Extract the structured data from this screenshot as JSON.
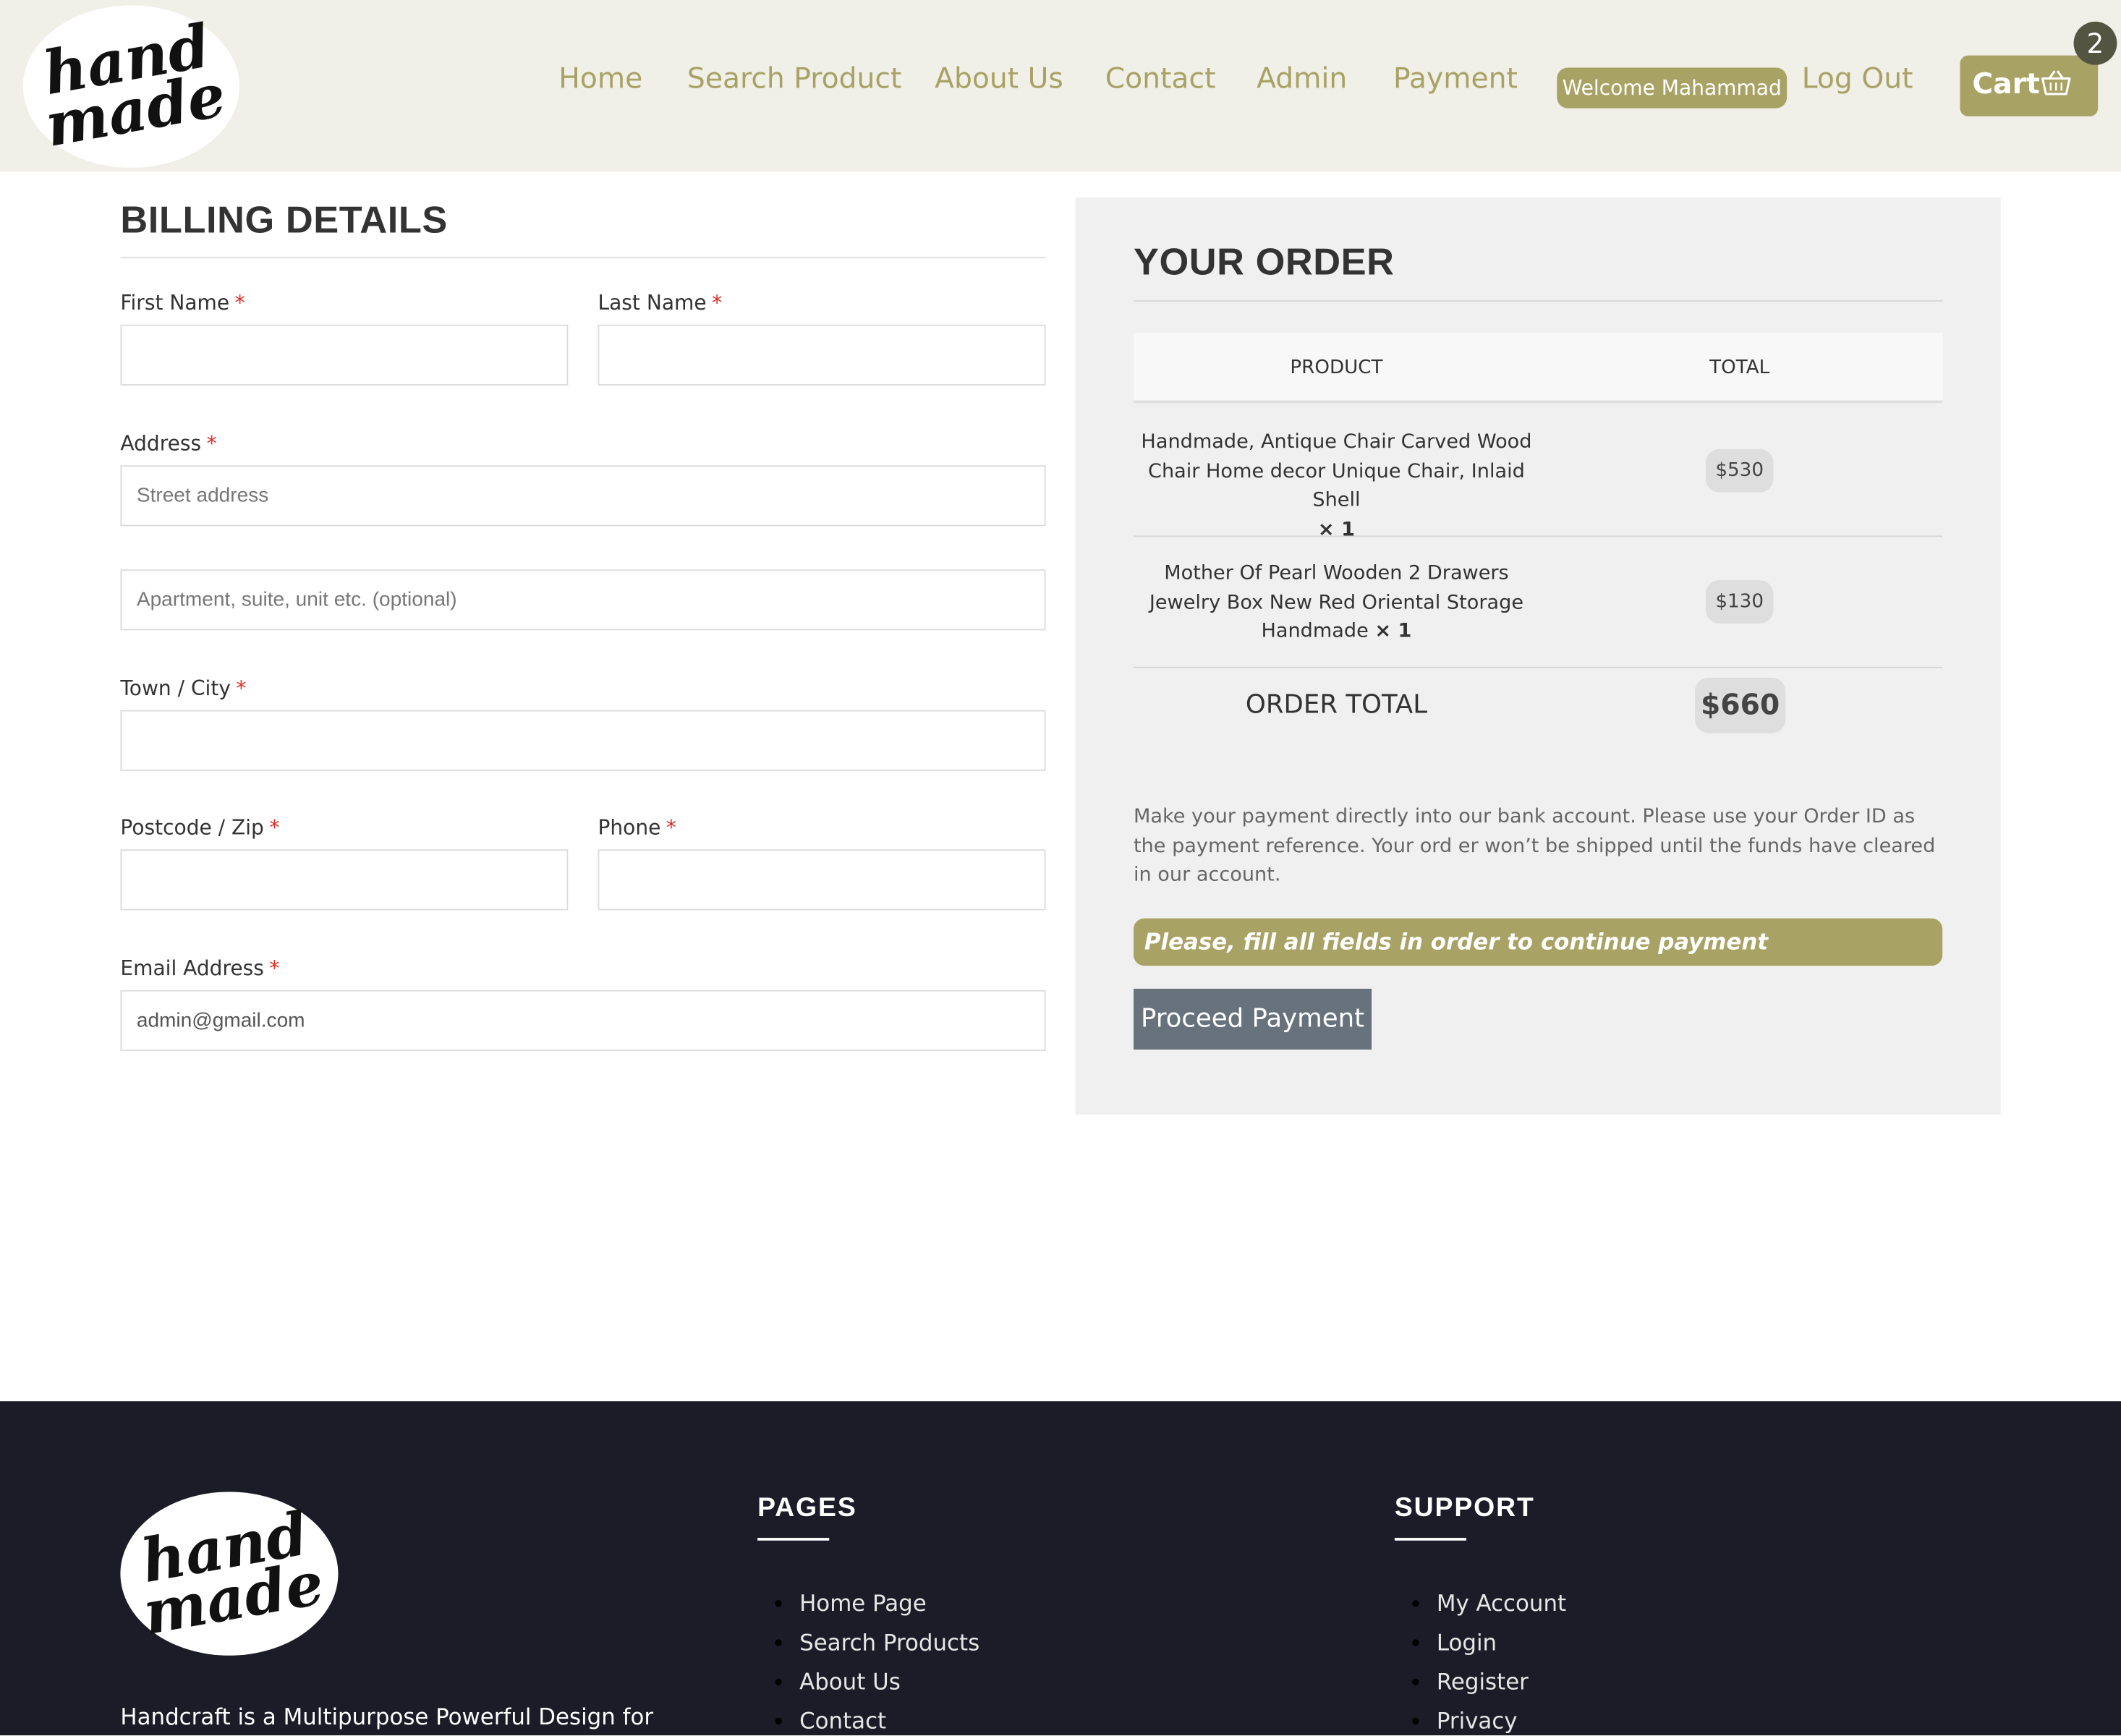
{
  "header": {
    "logo_text": "hand made",
    "nav": [
      "Home",
      "Search Product",
      "About Us",
      "Contact",
      "Admin",
      "Payment"
    ],
    "welcome": "Welcome Mahammad",
    "logout": "Log Out",
    "cart_label": "Cart",
    "cart_count": "2"
  },
  "billing": {
    "title": "BILLING DETAILS",
    "required_mark": "*",
    "first_name_label": "First Name",
    "last_name_label": "Last Name",
    "address_label": "Address",
    "street_placeholder": "Street address",
    "apartment_placeholder": "Apartment, suite, unit etc. (optional)",
    "town_label": "Town / City",
    "postcode_label": "Postcode / Zip",
    "phone_label": "Phone",
    "email_label": "Email Address",
    "email_value": "admin@gmail.com"
  },
  "order": {
    "title": "YOUR ORDER",
    "col_product": "PRODUCT",
    "col_total": "TOTAL",
    "items": [
      {
        "name": "Handmade, Antique Chair Carved Wood Chair Home decor Unique Chair, Inlaid Shell",
        "qty": "× 1",
        "price": "$530"
      },
      {
        "name": "Mother Of Pearl Wooden 2 Drawers Jewelry Box New Red Oriental Storage Handmade",
        "qty": "× 1",
        "price": "$130"
      }
    ],
    "total_label": "ORDER TOTAL",
    "total_value": "$660",
    "payment_note": "Make your payment directly into our bank account. Please use your Order ID as the payment reference. Your ord er won’t be shipped until the funds have cleared in our account.",
    "warning": "Please, fill all fields in order to continue payment",
    "proceed_label": "Proceed Payment"
  },
  "footer": {
    "logo_text": "hand made",
    "pages_title": "PAGES",
    "pages_links": [
      "Home Page",
      "Search Products",
      "About Us",
      "Contact"
    ],
    "support_title": "SUPPORT",
    "support_links": [
      "My Account",
      "Login",
      "Register",
      "Privacy"
    ],
    "description": "Handcraft is a Multipurpose Powerful Design for"
  },
  "colors": {
    "accent": "#a9a265",
    "header_bg": "#f0efe8",
    "footer_bg": "#1c1c28",
    "button_grey": "#68727c",
    "required": "#e02b27"
  }
}
